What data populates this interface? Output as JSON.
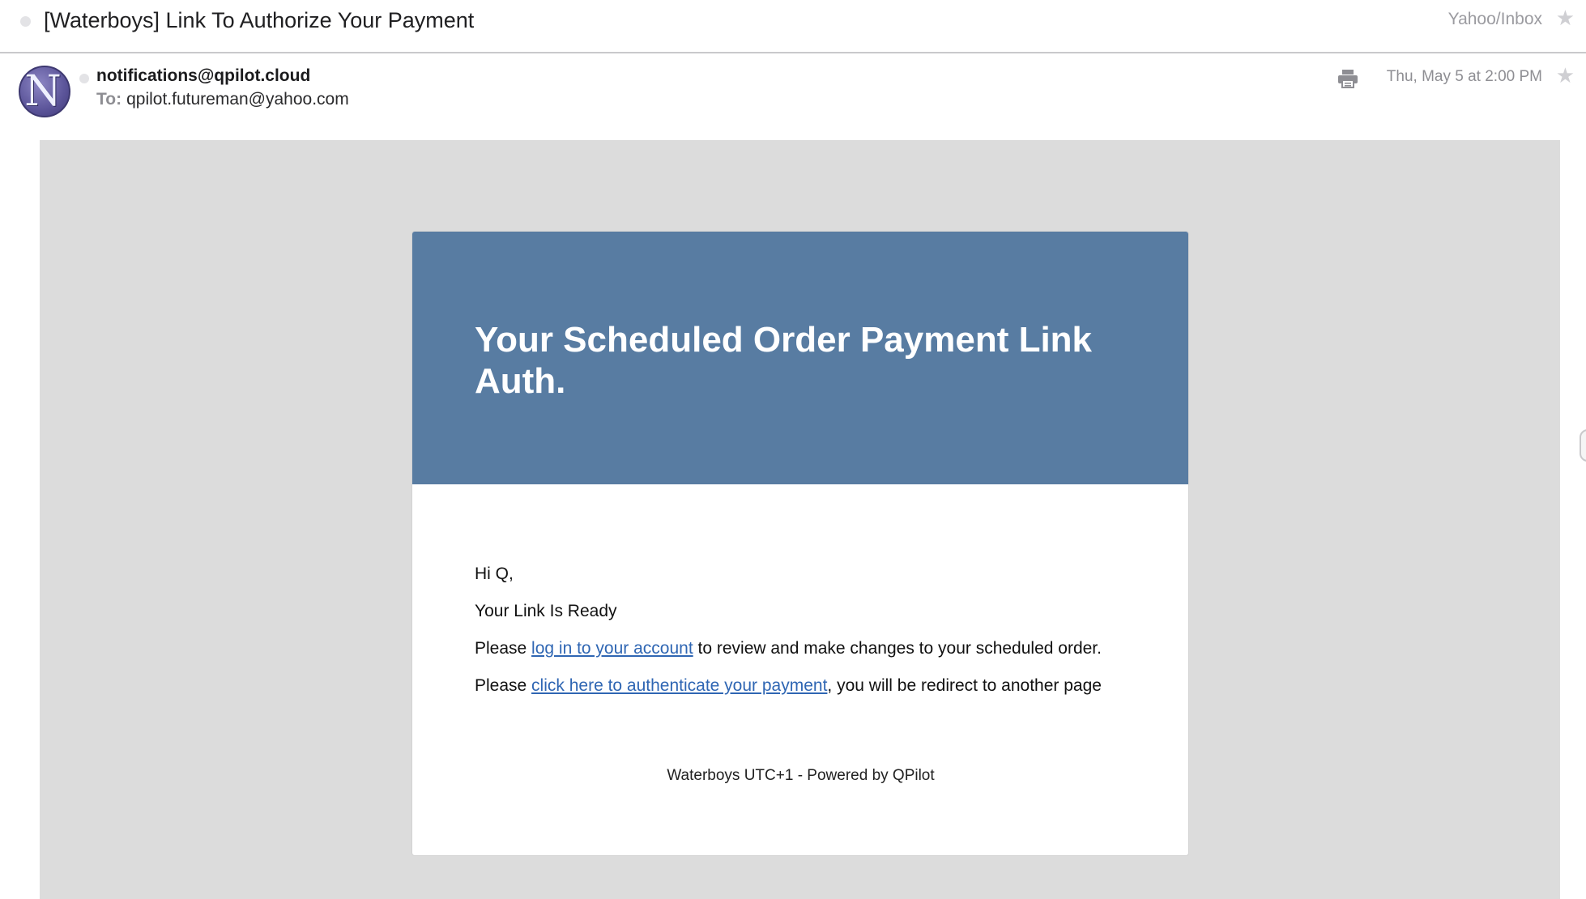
{
  "message": {
    "subject": "[Waterboys] Link To Authorize Your Payment",
    "folder": "Yahoo/Inbox",
    "sender": "notifications@qpilot.cloud",
    "to_label": "To:",
    "to_address": "qpilot.futureman@yahoo.com",
    "date": "Thu, May 5 at 2:00 PM",
    "avatar_letter": "N"
  },
  "email": {
    "headline": "Your Scheduled Order Payment Link Auth.",
    "greeting": "Hi Q,",
    "line1": "Your Link Is Ready",
    "line2_prefix": "Please ",
    "line2_link": "log in to your account",
    "line2_suffix": " to review and make changes to your scheduled order.",
    "line3_prefix": "Please ",
    "line3_link": "click here to authenticate your payment",
    "line3_suffix": ", you will be redirect to another page",
    "footer": "Waterboys UTC+1 - Powered by QPilot"
  },
  "colors": {
    "header_blue": "#587ca2",
    "link_blue": "#2f66b3",
    "email_background": "#dcdcdc"
  }
}
